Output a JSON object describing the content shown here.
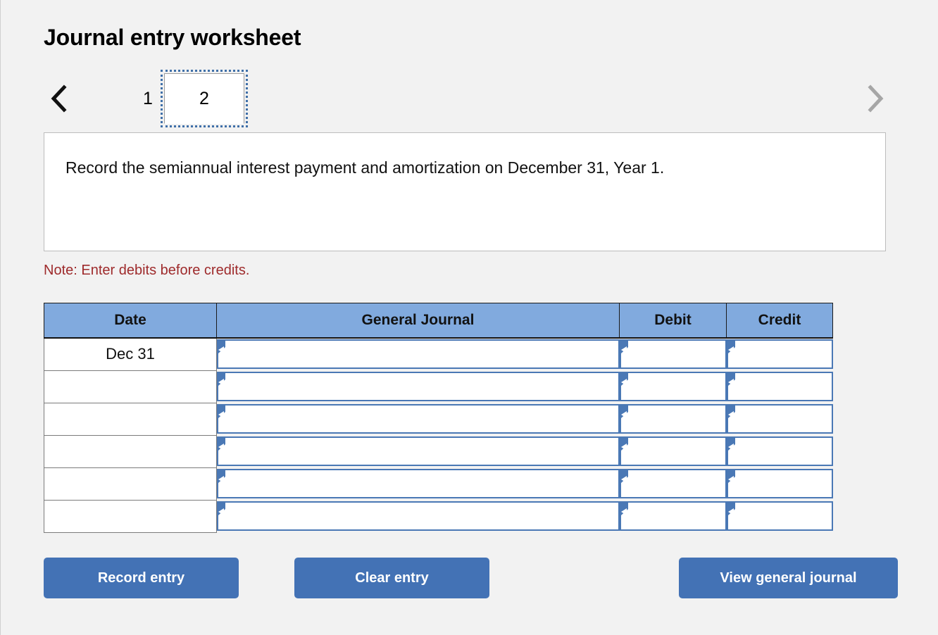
{
  "page": {
    "title": "Journal entry worksheet",
    "background_color": "#f2f2f2"
  },
  "tabs": {
    "prev_icon": "chevron-left-icon",
    "next_icon": "chevron-right-icon",
    "items": [
      {
        "label": "1",
        "active": false
      },
      {
        "label": "2",
        "active": true
      }
    ]
  },
  "description": {
    "text": "Record the semiannual interest payment and amortization on December 31, Year 1."
  },
  "note": {
    "text": "Note: Enter debits before credits.",
    "color": "#9e2a2b"
  },
  "journal": {
    "headers": {
      "date": "Date",
      "general_journal": "General Journal",
      "debit": "Debit",
      "credit": "Credit"
    },
    "header_color": "#81aade",
    "input_border_color": "#4a78b5",
    "rows": [
      {
        "date": "Dec 31",
        "general_journal": "",
        "debit": "",
        "credit": ""
      },
      {
        "date": "",
        "general_journal": "",
        "debit": "",
        "credit": ""
      },
      {
        "date": "",
        "general_journal": "",
        "debit": "",
        "credit": ""
      },
      {
        "date": "",
        "general_journal": "",
        "debit": "",
        "credit": ""
      },
      {
        "date": "",
        "general_journal": "",
        "debit": "",
        "credit": ""
      },
      {
        "date": "",
        "general_journal": "",
        "debit": "",
        "credit": ""
      }
    ]
  },
  "buttons": {
    "record": "Record entry",
    "clear": "Clear entry",
    "view": "View general journal",
    "color": "#4372b5"
  }
}
